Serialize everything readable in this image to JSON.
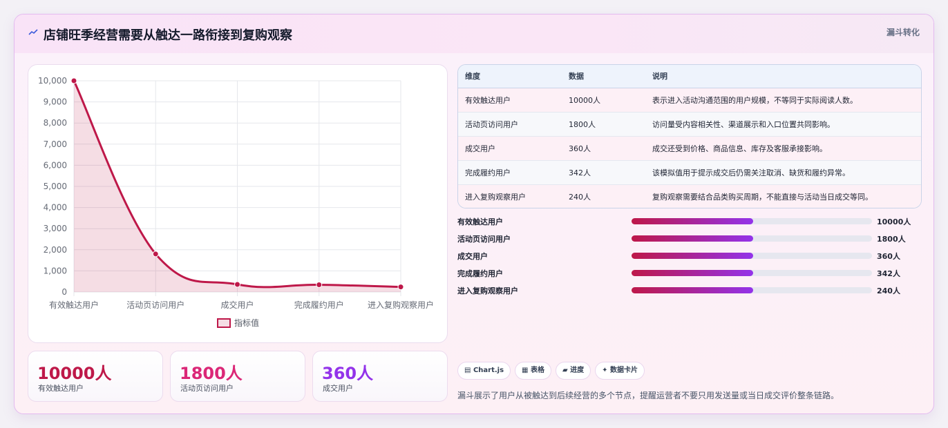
{
  "header": {
    "title": "店铺旺季经营需要从触达一路衔接到复购观察",
    "tag": "漏斗转化"
  },
  "chart_data": {
    "type": "line",
    "categories": [
      "有效触达用户",
      "活动页访问用户",
      "成交用户",
      "完成履约用户",
      "进入复购观察用户"
    ],
    "series": [
      {
        "name": "指标值",
        "values": [
          10000,
          1800,
          360,
          342,
          240
        ]
      }
    ],
    "ylim": [
      0,
      10000
    ],
    "yticks": [
      "0",
      "1,000",
      "2,000",
      "3,000",
      "4,000",
      "5,000",
      "6,000",
      "7,000",
      "8,000",
      "9,000",
      "10,000"
    ],
    "area_fill": true,
    "grid": true,
    "legend": "bottom",
    "color": "#be1849"
  },
  "stats": [
    {
      "value": "10000人",
      "label": "有效触达用户",
      "color": "#be1849"
    },
    {
      "value": "1800人",
      "label": "活动页访问用户",
      "color": "#db2777"
    },
    {
      "value": "360人",
      "label": "成交用户",
      "color": "#9333ea"
    }
  ],
  "table": {
    "headers": [
      "维度",
      "数据",
      "说明"
    ],
    "rows": [
      [
        "有效触达用户",
        "10000人",
        "表示进入活动沟通范围的用户规模，不等同于实际阅读人数。"
      ],
      [
        "活动页访问用户",
        "1800人",
        "访问量受内容相关性、渠道展示和入口位置共同影响。"
      ],
      [
        "成交用户",
        "360人",
        "成交还受到价格、商品信息、库存及客服承接影响。"
      ],
      [
        "完成履约用户",
        "342人",
        "该模拟值用于提示成交后仍需关注取消、缺货和履约异常。"
      ],
      [
        "进入复购观察用户",
        "240人",
        "复购观察需要结合品类购买周期，不能直接与活动当日成交等同。"
      ]
    ]
  },
  "progress": [
    {
      "label": "有效触达用户",
      "value": "10000人",
      "fill": 0.505
    },
    {
      "label": "活动页访问用户",
      "value": "1800人",
      "fill": 0.505
    },
    {
      "label": "成交用户",
      "value": "360人",
      "fill": 0.505
    },
    {
      "label": "完成履约用户",
      "value": "342人",
      "fill": 0.505
    },
    {
      "label": "进入复购观察用户",
      "value": "240人",
      "fill": 0.505
    }
  ],
  "chips": [
    {
      "icon": "chart-icon",
      "glyph": "▤",
      "label": "Chart.js"
    },
    {
      "icon": "table-icon",
      "glyph": "▦",
      "label": "表格"
    },
    {
      "icon": "progress-icon",
      "glyph": "▰",
      "label": "进度"
    },
    {
      "icon": "sparkle-icon",
      "glyph": "✦",
      "label": "数据卡片"
    }
  ],
  "footnote": "漏斗展示了用户从被触达到后续经营的多个节点，提醒运营者不要只用发送量或当日成交评价整条链路。"
}
